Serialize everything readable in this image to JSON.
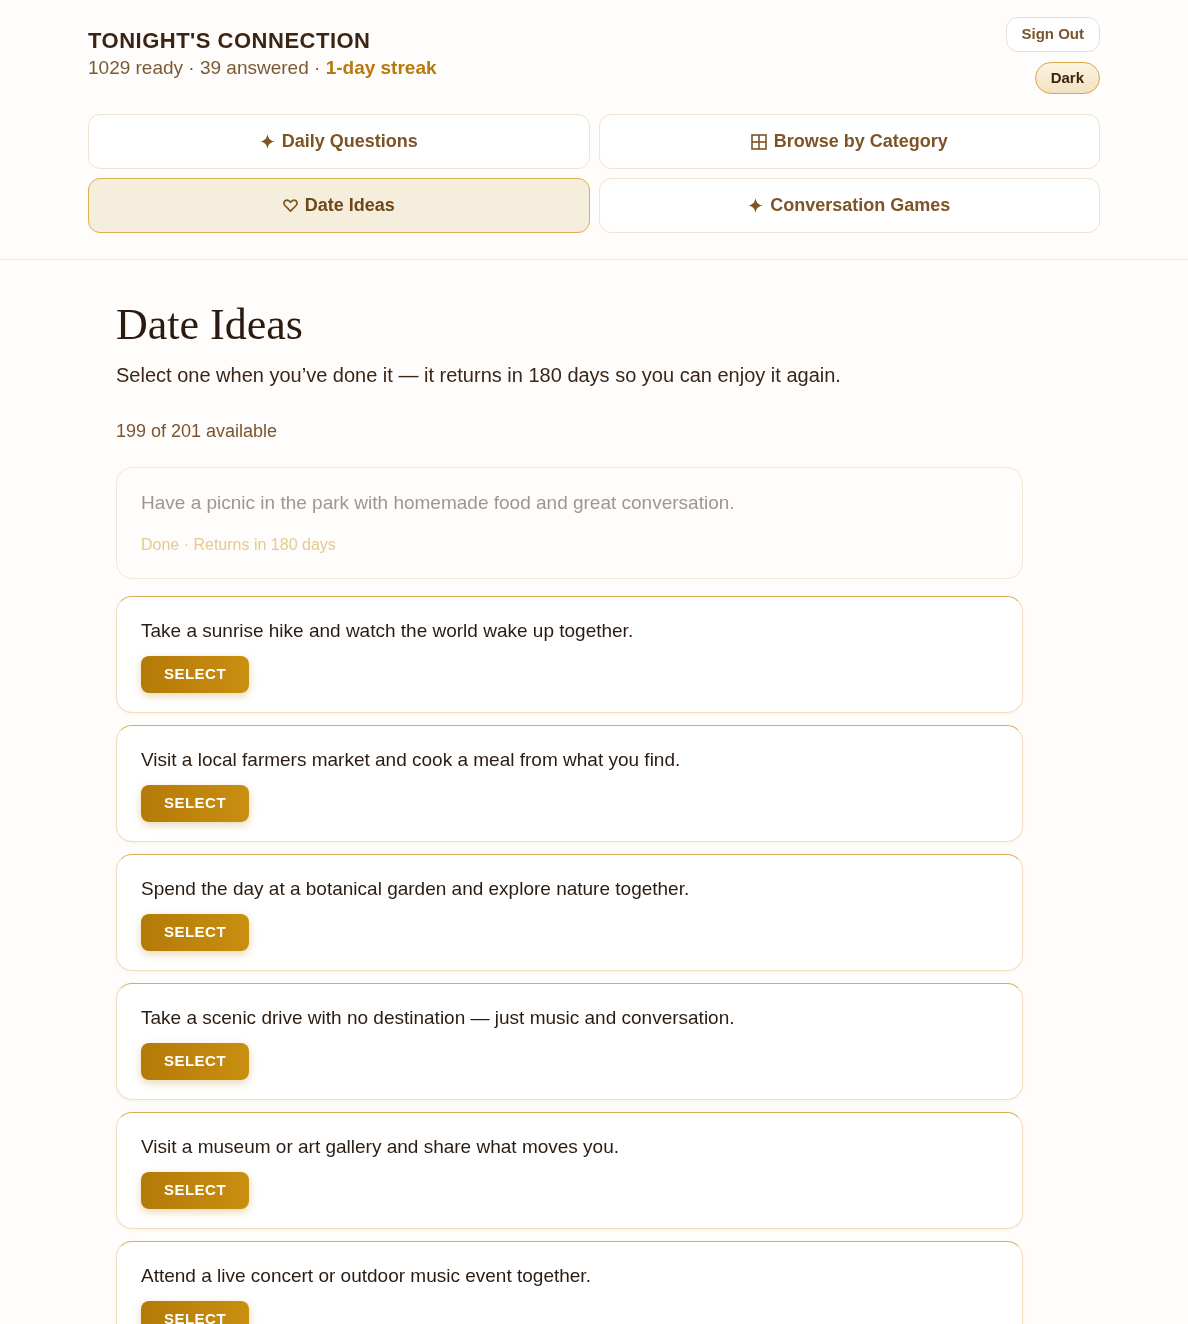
{
  "header": {
    "title": "TONIGHT'S CONNECTION",
    "stats": "1029 ready · 39 answered · **1-day streak**"
  },
  "account": {
    "sign_out": "Sign Out",
    "theme_toggle": "Dark"
  },
  "tabs": [
    {
      "label": "Daily Questions",
      "kind": "sparkle",
      "selected": false
    },
    {
      "label": "Browse by Category",
      "kind": "grid",
      "selected": false
    },
    {
      "label": "Date Ideas",
      "kind": "heart",
      "selected": true
    },
    {
      "label": "Conversation Games",
      "kind": "sparkle",
      "selected": false
    }
  ],
  "page": {
    "title": "Date Ideas",
    "subtitle": "Select one when you’ve done it — it returns in 180 days so you can enjoy it again.",
    "count": "199 of 201 available"
  },
  "ideas": [
    {
      "text": "Have a picnic in the park with homemade food and great conversation.",
      "done": true,
      "status": "Done · Returns in 180 days"
    },
    {
      "text": "Take a sunrise hike and watch the world wake up together.",
      "done": false,
      "action": "SELECT"
    },
    {
      "text": "Visit a local farmers market and cook a meal from what you find.",
      "done": false,
      "action": "SELECT"
    },
    {
      "text": "Spend the day at a botanical garden and explore nature together.",
      "done": false,
      "action": "SELECT"
    },
    {
      "text": "Take a scenic drive with no destination — just music and conversation.",
      "done": false,
      "action": "SELECT"
    },
    {
      "text": "Visit a museum or art gallery and share what moves you.",
      "done": false,
      "action": "SELECT"
    },
    {
      "text": "Attend a live concert or outdoor music event together.",
      "done": false,
      "action": "SELECT"
    }
  ]
}
